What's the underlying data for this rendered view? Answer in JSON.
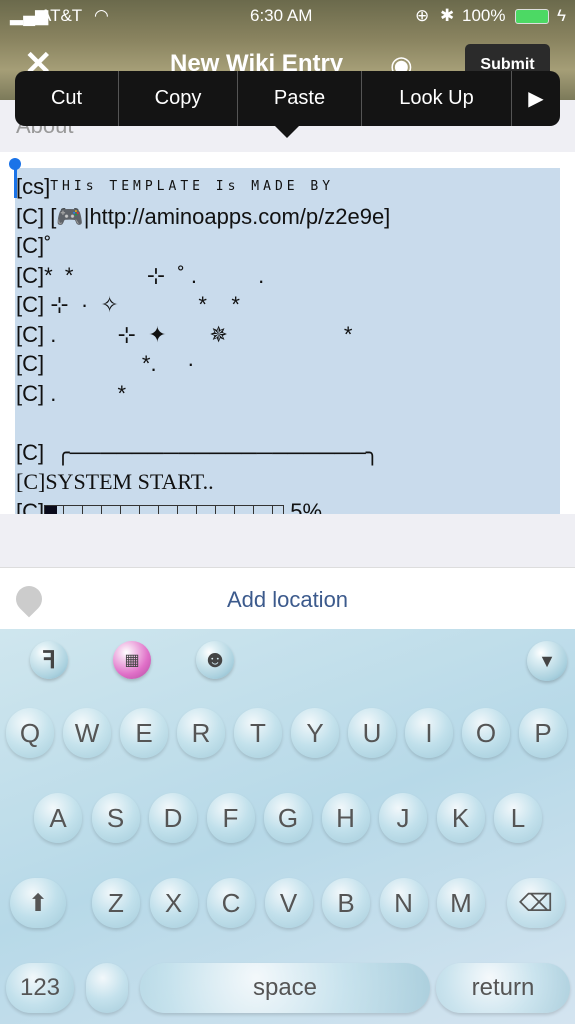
{
  "status": {
    "carrier": "AT&T",
    "time": "6:30 AM",
    "battery": "100%",
    "battery_color": "#4cd964"
  },
  "header": {
    "title": "New Wiki Entry",
    "submit": "Submit"
  },
  "edit_menu": [
    "Cut",
    "Copy",
    "Paste",
    "Look Up"
  ],
  "section_label": "About",
  "editor": {
    "line0_prefix": "[cs]",
    "line0_small": "THIs TEMPLATE Is MADE BY",
    "lines": [
      "[C] [🎮|http://aminoapps.com/p/z2e9e]",
      "[C]˚",
      "[C]*  *            ⊹  ˚ .          .",
      "[C] ⊹  ·  ✧             *    *",
      "[C] .          ⊹  ✦       ✵                   *",
      "[C]                *.     ·",
      "[C] .          *",
      "",
      "[C]  ╭───────────────────╮"
    ],
    "system": "[C]SYSTEM START..",
    "progress_prefix": "[C]",
    "progress_text": "5%",
    "progress": 5
  },
  "location": {
    "label": "Add location"
  },
  "keyboard": {
    "row1": [
      "Q",
      "W",
      "E",
      "R",
      "T",
      "Y",
      "U",
      "I",
      "O",
      "P"
    ],
    "row2": [
      "A",
      "S",
      "D",
      "F",
      "G",
      "H",
      "J",
      "K",
      "L"
    ],
    "row3": [
      "Z",
      "X",
      "C",
      "V",
      "B",
      "N",
      "M"
    ],
    "numbers": "123",
    "space": "space",
    "return": "return"
  }
}
